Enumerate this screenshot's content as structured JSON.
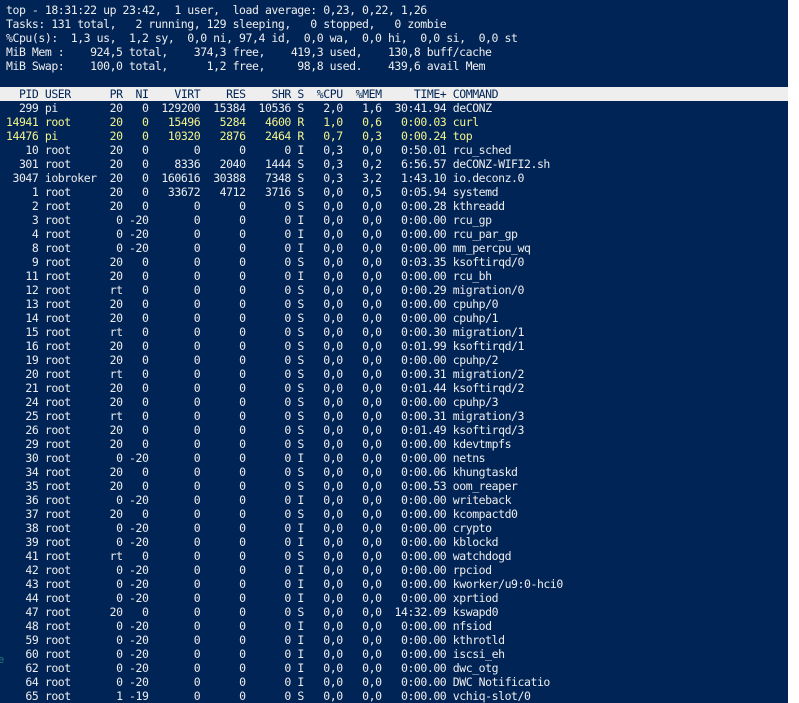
{
  "summary": {
    "line1": "top - 18:31:22 up 23:42,  1 user,  load average: 0,23, 0,22, 1,26",
    "line2": "Tasks: 131 total,   2 running, 129 sleeping,   0 stopped,   0 zombie",
    "line3": "%Cpu(s):  1,3 us,  1,2 sy,  0,0 ni, 97,4 id,  0,0 wa,  0,0 hi,  0,0 si,  0,0 st",
    "line4": "MiB Mem :    924,5 total,    374,3 free,    419,3 used,    130,8 buff/cache",
    "line5": "MiB Swap:    100,0 total,      1,2 free,     98,8 used.    439,6 avail Mem"
  },
  "columns": [
    "PID",
    "USER",
    "PR",
    "NI",
    "VIRT",
    "RES",
    "SHR",
    "S",
    "%CPU",
    "%MEM",
    "TIME+",
    "COMMAND"
  ],
  "processes": [
    {
      "pid": "299",
      "user": "pi",
      "pr": "20",
      "ni": "0",
      "virt": "129200",
      "res": "15384",
      "shr": "10536",
      "s": "S",
      "cpu": "2,0",
      "mem": "1,6",
      "time": "30:41.94",
      "cmd": "deCONZ",
      "hl": false
    },
    {
      "pid": "14941",
      "user": "root",
      "pr": "20",
      "ni": "0",
      "virt": "15496",
      "res": "5284",
      "shr": "4600",
      "s": "R",
      "cpu": "1,0",
      "mem": "0,6",
      "time": "0:00.03",
      "cmd": "curl",
      "hl": true
    },
    {
      "pid": "14476",
      "user": "pi",
      "pr": "20",
      "ni": "0",
      "virt": "10320",
      "res": "2876",
      "shr": "2464",
      "s": "R",
      "cpu": "0,7",
      "mem": "0,3",
      "time": "0:00.24",
      "cmd": "top",
      "hl": true
    },
    {
      "pid": "10",
      "user": "root",
      "pr": "20",
      "ni": "0",
      "virt": "0",
      "res": "0",
      "shr": "0",
      "s": "I",
      "cpu": "0,3",
      "mem": "0,0",
      "time": "0:50.01",
      "cmd": "rcu_sched",
      "hl": false
    },
    {
      "pid": "301",
      "user": "root",
      "pr": "20",
      "ni": "0",
      "virt": "8336",
      "res": "2040",
      "shr": "1444",
      "s": "S",
      "cpu": "0,3",
      "mem": "0,2",
      "time": "6:56.57",
      "cmd": "deCONZ-WIFI2.sh",
      "hl": false
    },
    {
      "pid": "3047",
      "user": "iobroker",
      "pr": "20",
      "ni": "0",
      "virt": "160616",
      "res": "30388",
      "shr": "7348",
      "s": "S",
      "cpu": "0,3",
      "mem": "3,2",
      "time": "1:43.10",
      "cmd": "io.deconz.0",
      "hl": false
    },
    {
      "pid": "1",
      "user": "root",
      "pr": "20",
      "ni": "0",
      "virt": "33672",
      "res": "4712",
      "shr": "3716",
      "s": "S",
      "cpu": "0,0",
      "mem": "0,5",
      "time": "0:05.94",
      "cmd": "systemd",
      "hl": false
    },
    {
      "pid": "2",
      "user": "root",
      "pr": "20",
      "ni": "0",
      "virt": "0",
      "res": "0",
      "shr": "0",
      "s": "S",
      "cpu": "0,0",
      "mem": "0,0",
      "time": "0:00.28",
      "cmd": "kthreadd",
      "hl": false
    },
    {
      "pid": "3",
      "user": "root",
      "pr": "0",
      "ni": "-20",
      "virt": "0",
      "res": "0",
      "shr": "0",
      "s": "I",
      "cpu": "0,0",
      "mem": "0,0",
      "time": "0:00.00",
      "cmd": "rcu_gp",
      "hl": false
    },
    {
      "pid": "4",
      "user": "root",
      "pr": "0",
      "ni": "-20",
      "virt": "0",
      "res": "0",
      "shr": "0",
      "s": "I",
      "cpu": "0,0",
      "mem": "0,0",
      "time": "0:00.00",
      "cmd": "rcu_par_gp",
      "hl": false
    },
    {
      "pid": "8",
      "user": "root",
      "pr": "0",
      "ni": "-20",
      "virt": "0",
      "res": "0",
      "shr": "0",
      "s": "I",
      "cpu": "0,0",
      "mem": "0,0",
      "time": "0:00.00",
      "cmd": "mm_percpu_wq",
      "hl": false
    },
    {
      "pid": "9",
      "user": "root",
      "pr": "20",
      "ni": "0",
      "virt": "0",
      "res": "0",
      "shr": "0",
      "s": "S",
      "cpu": "0,0",
      "mem": "0,0",
      "time": "0:03.35",
      "cmd": "ksoftirqd/0",
      "hl": false
    },
    {
      "pid": "11",
      "user": "root",
      "pr": "20",
      "ni": "0",
      "virt": "0",
      "res": "0",
      "shr": "0",
      "s": "I",
      "cpu": "0,0",
      "mem": "0,0",
      "time": "0:00.00",
      "cmd": "rcu_bh",
      "hl": false
    },
    {
      "pid": "12",
      "user": "root",
      "pr": "rt",
      "ni": "0",
      "virt": "0",
      "res": "0",
      "shr": "0",
      "s": "S",
      "cpu": "0,0",
      "mem": "0,0",
      "time": "0:00.29",
      "cmd": "migration/0",
      "hl": false
    },
    {
      "pid": "13",
      "user": "root",
      "pr": "20",
      "ni": "0",
      "virt": "0",
      "res": "0",
      "shr": "0",
      "s": "S",
      "cpu": "0,0",
      "mem": "0,0",
      "time": "0:00.00",
      "cmd": "cpuhp/0",
      "hl": false
    },
    {
      "pid": "14",
      "user": "root",
      "pr": "20",
      "ni": "0",
      "virt": "0",
      "res": "0",
      "shr": "0",
      "s": "S",
      "cpu": "0,0",
      "mem": "0,0",
      "time": "0:00.00",
      "cmd": "cpuhp/1",
      "hl": false
    },
    {
      "pid": "15",
      "user": "root",
      "pr": "rt",
      "ni": "0",
      "virt": "0",
      "res": "0",
      "shr": "0",
      "s": "S",
      "cpu": "0,0",
      "mem": "0,0",
      "time": "0:00.30",
      "cmd": "migration/1",
      "hl": false
    },
    {
      "pid": "16",
      "user": "root",
      "pr": "20",
      "ni": "0",
      "virt": "0",
      "res": "0",
      "shr": "0",
      "s": "S",
      "cpu": "0,0",
      "mem": "0,0",
      "time": "0:01.99",
      "cmd": "ksoftirqd/1",
      "hl": false
    },
    {
      "pid": "19",
      "user": "root",
      "pr": "20",
      "ni": "0",
      "virt": "0",
      "res": "0",
      "shr": "0",
      "s": "S",
      "cpu": "0,0",
      "mem": "0,0",
      "time": "0:00.00",
      "cmd": "cpuhp/2",
      "hl": false
    },
    {
      "pid": "20",
      "user": "root",
      "pr": "rt",
      "ni": "0",
      "virt": "0",
      "res": "0",
      "shr": "0",
      "s": "S",
      "cpu": "0,0",
      "mem": "0,0",
      "time": "0:00.31",
      "cmd": "migration/2",
      "hl": false
    },
    {
      "pid": "21",
      "user": "root",
      "pr": "20",
      "ni": "0",
      "virt": "0",
      "res": "0",
      "shr": "0",
      "s": "S",
      "cpu": "0,0",
      "mem": "0,0",
      "time": "0:01.44",
      "cmd": "ksoftirqd/2",
      "hl": false
    },
    {
      "pid": "24",
      "user": "root",
      "pr": "20",
      "ni": "0",
      "virt": "0",
      "res": "0",
      "shr": "0",
      "s": "S",
      "cpu": "0,0",
      "mem": "0,0",
      "time": "0:00.00",
      "cmd": "cpuhp/3",
      "hl": false
    },
    {
      "pid": "25",
      "user": "root",
      "pr": "rt",
      "ni": "0",
      "virt": "0",
      "res": "0",
      "shr": "0",
      "s": "S",
      "cpu": "0,0",
      "mem": "0,0",
      "time": "0:00.31",
      "cmd": "migration/3",
      "hl": false
    },
    {
      "pid": "26",
      "user": "root",
      "pr": "20",
      "ni": "0",
      "virt": "0",
      "res": "0",
      "shr": "0",
      "s": "S",
      "cpu": "0,0",
      "mem": "0,0",
      "time": "0:01.49",
      "cmd": "ksoftirqd/3",
      "hl": false
    },
    {
      "pid": "29",
      "user": "root",
      "pr": "20",
      "ni": "0",
      "virt": "0",
      "res": "0",
      "shr": "0",
      "s": "S",
      "cpu": "0,0",
      "mem": "0,0",
      "time": "0:00.00",
      "cmd": "kdevtmpfs",
      "hl": false
    },
    {
      "pid": "30",
      "user": "root",
      "pr": "0",
      "ni": "-20",
      "virt": "0",
      "res": "0",
      "shr": "0",
      "s": "I",
      "cpu": "0,0",
      "mem": "0,0",
      "time": "0:00.00",
      "cmd": "netns",
      "hl": false
    },
    {
      "pid": "34",
      "user": "root",
      "pr": "20",
      "ni": "0",
      "virt": "0",
      "res": "0",
      "shr": "0",
      "s": "S",
      "cpu": "0,0",
      "mem": "0,0",
      "time": "0:00.06",
      "cmd": "khungtaskd",
      "hl": false
    },
    {
      "pid": "35",
      "user": "root",
      "pr": "20",
      "ni": "0",
      "virt": "0",
      "res": "0",
      "shr": "0",
      "s": "S",
      "cpu": "0,0",
      "mem": "0,0",
      "time": "0:00.53",
      "cmd": "oom_reaper",
      "hl": false
    },
    {
      "pid": "36",
      "user": "root",
      "pr": "0",
      "ni": "-20",
      "virt": "0",
      "res": "0",
      "shr": "0",
      "s": "I",
      "cpu": "0,0",
      "mem": "0,0",
      "time": "0:00.00",
      "cmd": "writeback",
      "hl": false
    },
    {
      "pid": "37",
      "user": "root",
      "pr": "20",
      "ni": "0",
      "virt": "0",
      "res": "0",
      "shr": "0",
      "s": "S",
      "cpu": "0,0",
      "mem": "0,0",
      "time": "0:00.00",
      "cmd": "kcompactd0",
      "hl": false
    },
    {
      "pid": "38",
      "user": "root",
      "pr": "0",
      "ni": "-20",
      "virt": "0",
      "res": "0",
      "shr": "0",
      "s": "I",
      "cpu": "0,0",
      "mem": "0,0",
      "time": "0:00.00",
      "cmd": "crypto",
      "hl": false
    },
    {
      "pid": "39",
      "user": "root",
      "pr": "0",
      "ni": "-20",
      "virt": "0",
      "res": "0",
      "shr": "0",
      "s": "I",
      "cpu": "0,0",
      "mem": "0,0",
      "time": "0:00.00",
      "cmd": "kblockd",
      "hl": false
    },
    {
      "pid": "41",
      "user": "root",
      "pr": "rt",
      "ni": "0",
      "virt": "0",
      "res": "0",
      "shr": "0",
      "s": "S",
      "cpu": "0,0",
      "mem": "0,0",
      "time": "0:00.00",
      "cmd": "watchdogd",
      "hl": false
    },
    {
      "pid": "42",
      "user": "root",
      "pr": "0",
      "ni": "-20",
      "virt": "0",
      "res": "0",
      "shr": "0",
      "s": "I",
      "cpu": "0,0",
      "mem": "0,0",
      "time": "0:00.00",
      "cmd": "rpciod",
      "hl": false
    },
    {
      "pid": "43",
      "user": "root",
      "pr": "0",
      "ni": "-20",
      "virt": "0",
      "res": "0",
      "shr": "0",
      "s": "I",
      "cpu": "0,0",
      "mem": "0,0",
      "time": "0:00.00",
      "cmd": "kworker/u9:0-hci0",
      "hl": false
    },
    {
      "pid": "44",
      "user": "root",
      "pr": "0",
      "ni": "-20",
      "virt": "0",
      "res": "0",
      "shr": "0",
      "s": "I",
      "cpu": "0,0",
      "mem": "0,0",
      "time": "0:00.00",
      "cmd": "xprtiod",
      "hl": false
    },
    {
      "pid": "47",
      "user": "root",
      "pr": "20",
      "ni": "0",
      "virt": "0",
      "res": "0",
      "shr": "0",
      "s": "S",
      "cpu": "0,0",
      "mem": "0,0",
      "time": "14:32.09",
      "cmd": "kswapd0",
      "hl": false
    },
    {
      "pid": "48",
      "user": "root",
      "pr": "0",
      "ni": "-20",
      "virt": "0",
      "res": "0",
      "shr": "0",
      "s": "I",
      "cpu": "0,0",
      "mem": "0,0",
      "time": "0:00.00",
      "cmd": "nfsiod",
      "hl": false
    },
    {
      "pid": "59",
      "user": "root",
      "pr": "0",
      "ni": "-20",
      "virt": "0",
      "res": "0",
      "shr": "0",
      "s": "I",
      "cpu": "0,0",
      "mem": "0,0",
      "time": "0:00.00",
      "cmd": "kthrotld",
      "hl": false
    },
    {
      "pid": "60",
      "user": "root",
      "pr": "0",
      "ni": "-20",
      "virt": "0",
      "res": "0",
      "shr": "0",
      "s": "I",
      "cpu": "0,0",
      "mem": "0,0",
      "time": "0:00.00",
      "cmd": "iscsi_eh",
      "hl": false
    },
    {
      "pid": "62",
      "user": "root",
      "pr": "0",
      "ni": "-20",
      "virt": "0",
      "res": "0",
      "shr": "0",
      "s": "I",
      "cpu": "0,0",
      "mem": "0,0",
      "time": "0:00.00",
      "cmd": "dwc_otg",
      "hl": false
    },
    {
      "pid": "64",
      "user": "root",
      "pr": "0",
      "ni": "-20",
      "virt": "0",
      "res": "0",
      "shr": "0",
      "s": "I",
      "cpu": "0,0",
      "mem": "0,0",
      "time": "0:00.00",
      "cmd": "DWC Notificatio",
      "hl": false
    },
    {
      "pid": "65",
      "user": "root",
      "pr": "1",
      "ni": "-19",
      "virt": "0",
      "res": "0",
      "shr": "0",
      "s": "S",
      "cpu": "0,0",
      "mem": "0,0",
      "time": "0:00.00",
      "cmd": "vchiq-slot/0",
      "hl": false
    }
  ],
  "left_edge_glyphs": [
    "e",
    "l"
  ],
  "colors": {
    "background": "#012456",
    "foreground": "#eeeeee",
    "highlight": "#f4f48c",
    "header_bg": "#eeeeee"
  }
}
